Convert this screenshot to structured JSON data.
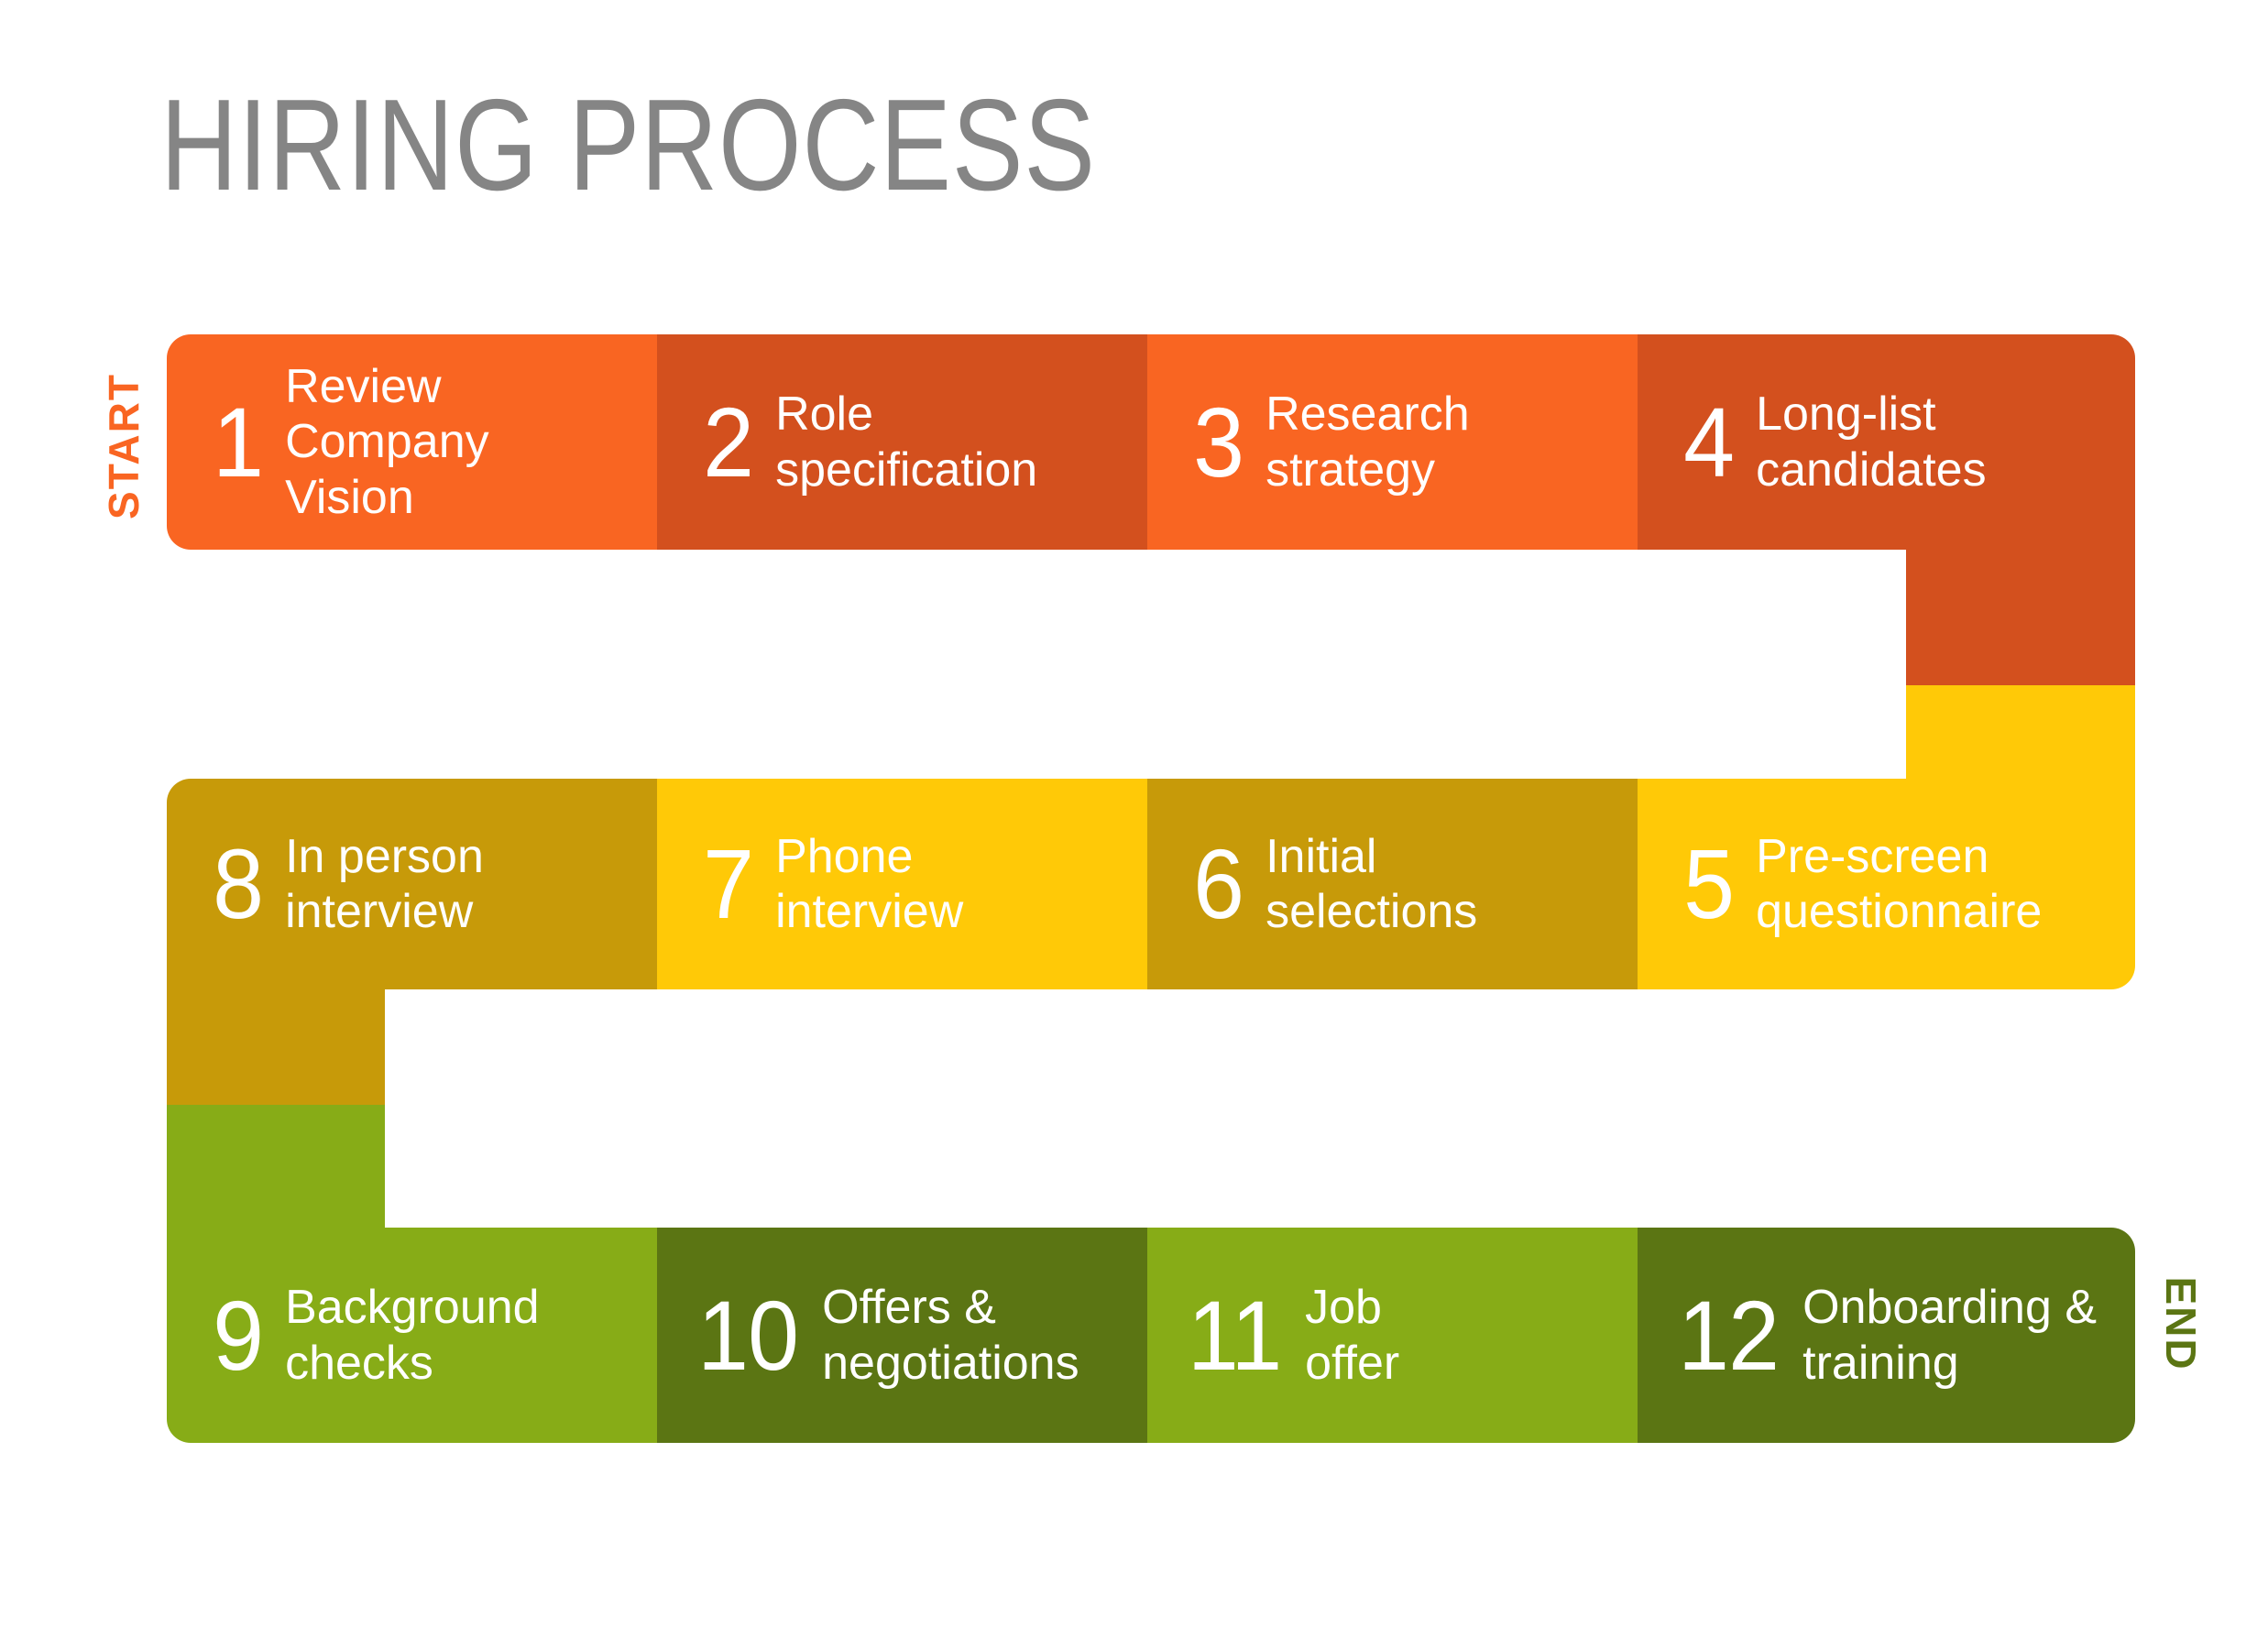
{
  "title": "HIRING PROCESS",
  "markers": {
    "start": "START",
    "end": "END",
    "start_color": "#F96522",
    "end_color": "#5B7513"
  },
  "palette": {
    "orange_light": "#F96522",
    "orange_dark": "#D3501E",
    "yellow_light": "#FFC907",
    "yellow_dark": "#C79A09",
    "green_light": "#87AC17",
    "green_dark": "#5B7513",
    "title_gray": "#858585",
    "background": "#FFFFFF",
    "text_on_step": "#FFFFFF"
  },
  "rows": [
    {
      "name": "row-1",
      "direction": "left-to-right",
      "steps": [
        {
          "number": "1",
          "label": "Review\nCompany\nVision",
          "color": "#F96522"
        },
        {
          "number": "2",
          "label": "Role\nspecification",
          "color": "#D3501E"
        },
        {
          "number": "3",
          "label": "Research\nstrategy",
          "color": "#F96522"
        },
        {
          "number": "4",
          "label": "Long-list\ncandidates",
          "color": "#D3501E"
        }
      ]
    },
    {
      "name": "row-2",
      "direction": "right-to-left",
      "steps": [
        {
          "number": "8",
          "label": "In person\ninterview",
          "color": "#C79A09"
        },
        {
          "number": "7",
          "label": "Phone\ninterview",
          "color": "#FFC907"
        },
        {
          "number": "6",
          "label": "Initial\nselections",
          "color": "#C79A09"
        },
        {
          "number": "5",
          "label": "Pre-screen\nquestionnaire",
          "color": "#FFC907"
        }
      ]
    },
    {
      "name": "row-3",
      "direction": "left-to-right",
      "steps": [
        {
          "number": "9",
          "label": "Background\nchecks",
          "color": "#87AC17"
        },
        {
          "number": "10",
          "label": "Offers &\nnegotiations",
          "color": "#5B7513"
        },
        {
          "number": "11",
          "label": "Job\noffer",
          "color": "#87AC17"
        },
        {
          "number": "12",
          "label": "Onboarding &\ntraining",
          "color": "#5B7513"
        }
      ]
    }
  ],
  "connectors": [
    {
      "name": "connector-4-to-5-upper",
      "color": "#D3501E"
    },
    {
      "name": "connector-4-to-5-lower",
      "color": "#FFC907"
    },
    {
      "name": "connector-8-to-9-upper",
      "color": "#C79A09"
    },
    {
      "name": "connector-8-to-9-lower",
      "color": "#87AC17"
    }
  ]
}
